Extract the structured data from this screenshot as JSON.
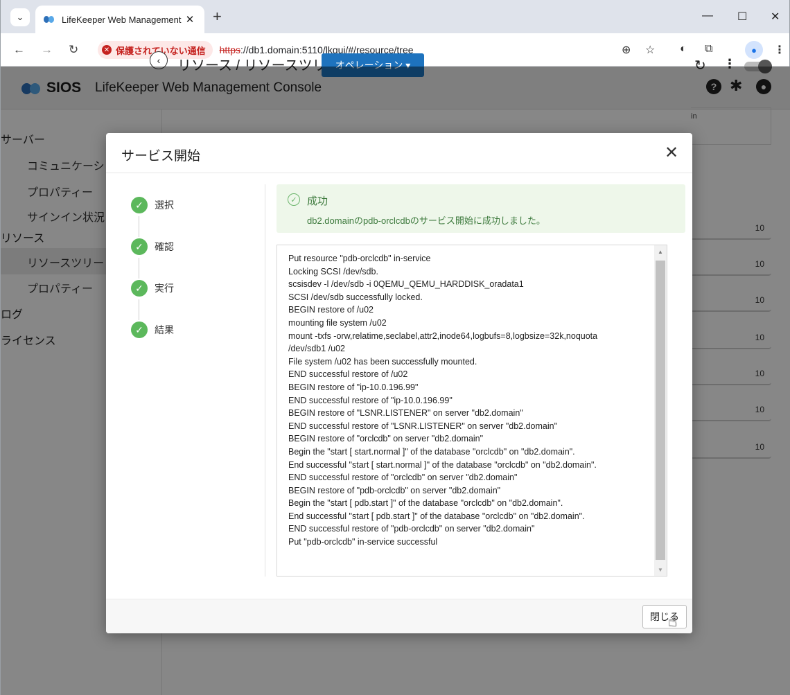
{
  "browser": {
    "tab_title": "LifeKeeper Web Management C",
    "tab_close": "✕",
    "new_tab": "+",
    "window_min": "—",
    "window_max": "☐",
    "window_close": "✕",
    "insecure_label": "保護されていない通信",
    "url_scheme": "https",
    "url_rest": "://db1.domain:5110/lkgui/#/resource/tree"
  },
  "app": {
    "brand": "SIOS",
    "title": "LifeKeeper Web Management Console",
    "breadcrumb": "リソース / リソースツリー",
    "operation_button": "オペレーション ▾"
  },
  "sidebar": {
    "items": [
      {
        "label": "サーバー"
      },
      {
        "label": "コミュニケーション"
      },
      {
        "label": "プロパティー"
      },
      {
        "label": "サインイン状況"
      },
      {
        "label": "リソース"
      },
      {
        "label": "リソースツリー"
      },
      {
        "label": "プロパティー"
      },
      {
        "label": "ログ"
      },
      {
        "label": "ライセンス"
      }
    ]
  },
  "background_table": {
    "column_header": "in",
    "rows": [
      "10",
      "10",
      "10",
      "10",
      "10",
      "10",
      "10"
    ]
  },
  "modal": {
    "title": "サービス開始",
    "close_icon": "✕",
    "steps": [
      {
        "label": "選択"
      },
      {
        "label": "確認"
      },
      {
        "label": "実行"
      },
      {
        "label": "結果"
      }
    ],
    "alert_title": "成功",
    "alert_message": "db2.domainのpdb-orclcdbのサービス開始に成功しました。",
    "log_lines": [
      "Put resource \"pdb-orclcdb\" in-service",
      "Locking SCSI /dev/sdb.",
      "scsisdev -l /dev/sdb -i 0QEMU_QEMU_HARDDISK_oradata1",
      "SCSI /dev/sdb successfully locked.",
      "BEGIN restore of /u02",
      "mounting file system /u02",
      "mount -txfs -orw,relatime,seclabel,attr2,inode64,logbufs=8,logbsize=32k,noquota",
      "/dev/sdb1 /u02",
      "File system /u02 has been successfully mounted.",
      "END successful restore of /u02",
      "BEGIN restore of \"ip-10.0.196.99\"",
      "END successful restore of \"ip-10.0.196.99\"",
      "BEGIN restore of \"LSNR.LISTENER\" on server \"db2.domain\"",
      "END successful restore of \"LSNR.LISTENER\" on server \"db2.domain\"",
      "BEGIN restore of \"orclcdb\" on server \"db2.domain\"",
      "Begin the \"start [ start.normal ]\" of the database \"orclcdb\" on \"db2.domain\".",
      "End successful \"start [ start.normal ]\" of the database \"orclcdb\" on \"db2.domain\".",
      "END successful restore of \"orclcdb\" on server \"db2.domain\"",
      "BEGIN restore of \"pdb-orclcdb\" on server \"db2.domain\"",
      "Begin the \"start [ pdb.start ]\" of the database \"orclcdb\" on \"db2.domain\".",
      "End successful \"start [ pdb.start ]\" of the database \"orclcdb\" on \"db2.domain\".",
      "END successful restore of \"pdb-orclcdb\" on server \"db2.domain\"",
      "Put \"pdb-orclcdb\" in-service successful"
    ],
    "close_button": "閉じる"
  },
  "colors": {
    "step_success": "#5cb85c",
    "alert_bg": "#eef7ea",
    "alert_text": "#3d7a3d",
    "primary_button": "#1e73be",
    "insecure": "#c5221f"
  }
}
